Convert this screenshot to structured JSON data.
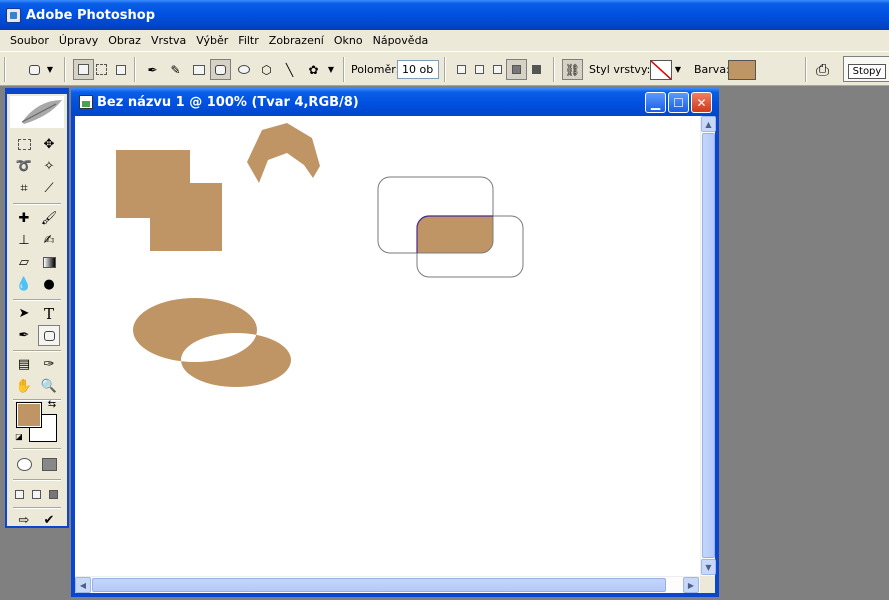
{
  "app": {
    "title": "Adobe Photoshop"
  },
  "menu": [
    "Soubor",
    "Úpravy",
    "Obraz",
    "Vrstva",
    "Výběr",
    "Filtr",
    "Zobrazení",
    "Okno",
    "Nápověda"
  ],
  "options_bar": {
    "radius_label": "Poloměr:",
    "radius_value": "10 ob",
    "layer_style_label": "Styl vrstvy:",
    "color_label": "Barva:",
    "color": "#c09565",
    "palette_tab": "Stopy"
  },
  "document": {
    "title": "Bez názvu 1 @ 100% (Tvar 4,RGB/8)",
    "shape_color": "#c09565"
  },
  "toolbox": {
    "foreground_color": "#c09565",
    "background_color": "#ffffff"
  },
  "colors": {
    "titlebar_blue": "#0050e0",
    "chrome": "#ece9d8",
    "workspace": "#808080"
  }
}
